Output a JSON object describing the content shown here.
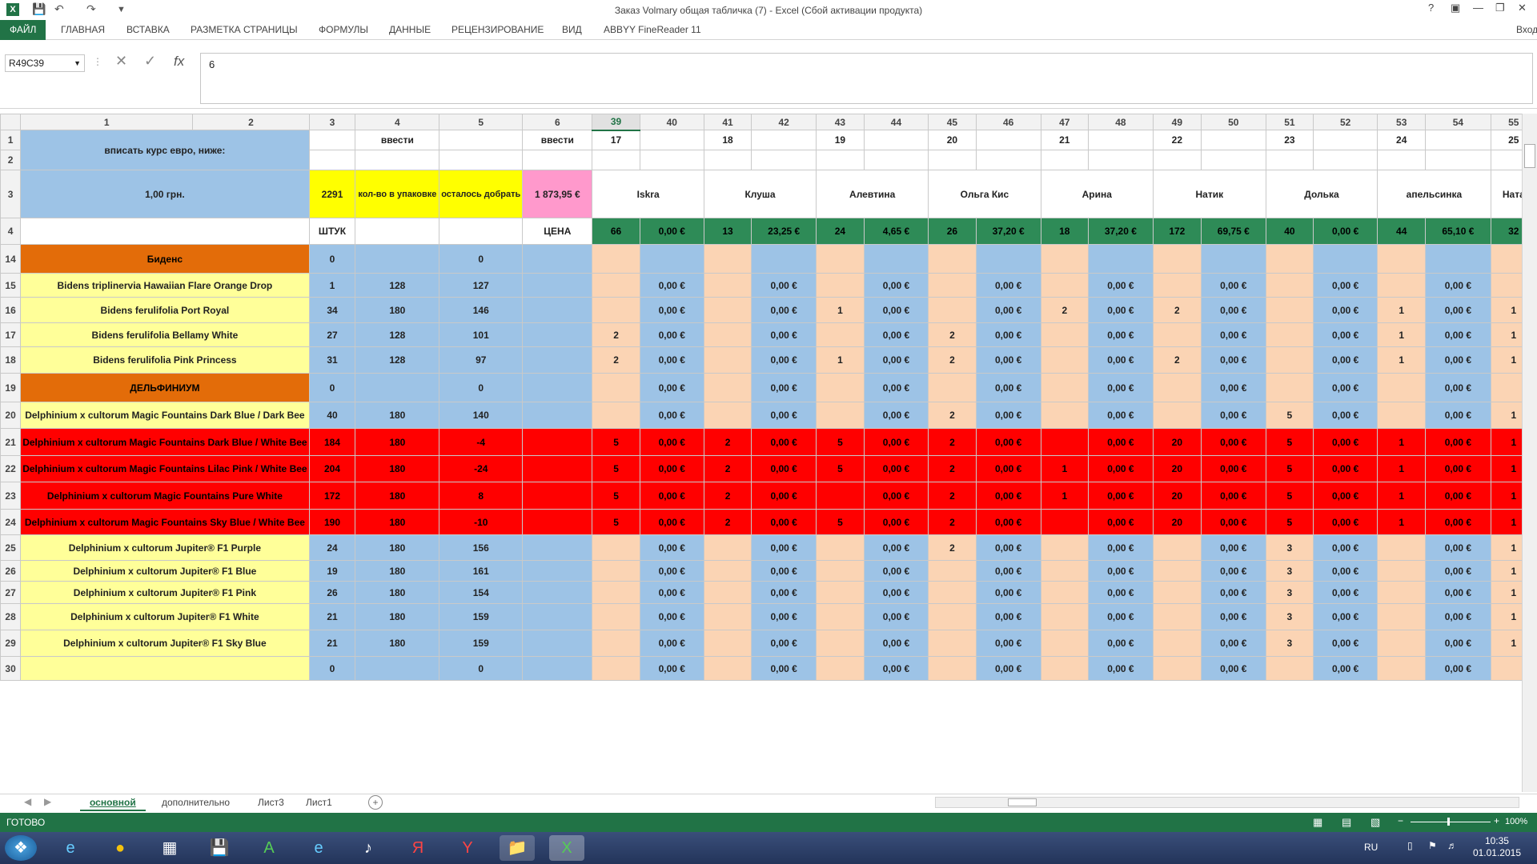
{
  "window": {
    "title": "Заказ Volmary общая табличка (7) - Excel (Сбой активации продукта)",
    "help": "?",
    "signin": "Вход"
  },
  "ribbon": {
    "tabs": [
      "ФАЙЛ",
      "ГЛАВНАЯ",
      "ВСТАВКА",
      "РАЗМЕТКА СТРАНИЦЫ",
      "ФОРМУЛЫ",
      "ДАННЫЕ",
      "РЕЦЕНЗИРОВАНИЕ",
      "ВИД",
      "ABBYY FineReader 11"
    ]
  },
  "formula_bar": {
    "name_box": "R49C39",
    "fx": "fx",
    "value": "6"
  },
  "columns": [
    "1",
    "2",
    "3",
    "4",
    "5",
    "6",
    "39",
    "40",
    "41",
    "42",
    "43",
    "44",
    "45",
    "46",
    "47",
    "48",
    "49",
    "50",
    "51",
    "52",
    "53",
    "54",
    "55"
  ],
  "selected_column": "39",
  "row1": {
    "label": "вписать курс евро, ниже:",
    "c4": "ввести",
    "c6": "ввести",
    "nums": [
      "17",
      "18",
      "19",
      "20",
      "21",
      "22",
      "23",
      "24",
      "25"
    ]
  },
  "row3": {
    "rate": "1,00 грн.",
    "total": "2291",
    "pack": "кол-во в упаковке",
    "left": "осталось добрать",
    "sum": "1 873,95 €"
  },
  "customers": [
    "Iskra",
    "Клуша",
    "Алевтина",
    "Ольга Кис",
    "Арина",
    "Натик",
    "Долька",
    "апельсинка",
    "Ната"
  ],
  "row4": {
    "unit": "ШТУК",
    "price": "ЦЕНА",
    "qty": [
      "66",
      "13",
      "24",
      "26",
      "18",
      "172",
      "40",
      "44",
      "32"
    ],
    "sums": [
      "0,00 €",
      "23,25 €",
      "4,65 €",
      "37,20 €",
      "37,20 €",
      "69,75 €",
      "0,00 €",
      "65,10 €"
    ]
  },
  "rows": [
    {
      "n": "14",
      "name": "Биденс",
      "cat": "bidens",
      "total": "0",
      "pack": "",
      "left": "0",
      "q": [
        "",
        "",
        "",
        "",
        "",
        "",
        "",
        "",
        ""
      ]
    },
    {
      "n": "15",
      "name": "Bidens triplinervia Hawaiian Flare Orange Drop",
      "cat": "y",
      "total": "1",
      "pack": "128",
      "left": "127",
      "q": [
        "",
        "",
        "",
        "",
        "",
        "",
        "",
        "",
        ""
      ]
    },
    {
      "n": "16",
      "name": "Bidens ferulifolia Port Royal",
      "cat": "y",
      "total": "34",
      "pack": "180",
      "left": "146",
      "q": [
        "",
        "",
        "1",
        "",
        "2",
        "2",
        "",
        "1",
        "1"
      ]
    },
    {
      "n": "17",
      "name": "Bidens ferulifolia Bellamy White",
      "cat": "y",
      "total": "27",
      "pack": "128",
      "left": "101",
      "q": [
        "2",
        "",
        "",
        "2",
        "",
        "",
        "",
        "1",
        "1"
      ]
    },
    {
      "n": "18",
      "name": "Bidens ferulifolia Pink Princess",
      "cat": "y",
      "total": "31",
      "pack": "128",
      "left": "97",
      "q": [
        "2",
        "",
        "1",
        "2",
        "",
        "2",
        "",
        "1",
        "1"
      ]
    },
    {
      "n": "19",
      "name": "ДЕЛЬФИНИУМ",
      "cat": "delph",
      "total": "0",
      "pack": "",
      "left": "0",
      "q": [
        "",
        "",
        "",
        "",
        "",
        "",
        "",
        "",
        ""
      ]
    },
    {
      "n": "20",
      "name": "Delphinium x cultorum Magic Fountains Dark Blue / Dark Bee",
      "cat": "y",
      "total": "40",
      "pack": "180",
      "left": "140",
      "q": [
        "",
        "",
        "",
        "2",
        "",
        "",
        "5",
        "",
        "1"
      ]
    },
    {
      "n": "21",
      "name": "Delphinium x cultorum Magic Fountains Dark Blue / White Bee",
      "cat": "r",
      "total": "184",
      "pack": "180",
      "left": "-4",
      "q": [
        "5",
        "2",
        "5",
        "2",
        "",
        "20",
        "5",
        "1",
        "1"
      ]
    },
    {
      "n": "22",
      "name": "Delphinium x cultorum Magic Fountains Lilac Pink / White Bee",
      "cat": "r",
      "total": "204",
      "pack": "180",
      "left": "-24",
      "q": [
        "5",
        "2",
        "5",
        "2",
        "1",
        "20",
        "5",
        "1",
        "1"
      ]
    },
    {
      "n": "23",
      "name": "Delphinium x cultorum Magic Fountains Pure White",
      "cat": "r",
      "total": "172",
      "pack": "180",
      "left": "8",
      "q": [
        "5",
        "2",
        "",
        "2",
        "1",
        "20",
        "5",
        "1",
        "1"
      ]
    },
    {
      "n": "24",
      "name": "Delphinium x cultorum Magic Fountains Sky Blue / White Bee",
      "cat": "r",
      "total": "190",
      "pack": "180",
      "left": "-10",
      "q": [
        "5",
        "2",
        "5",
        "2",
        "",
        "20",
        "5",
        "1",
        "1"
      ]
    },
    {
      "n": "25",
      "name": "Delphinium x cultorum Jupiter® F1 Purple",
      "cat": "y",
      "total": "24",
      "pack": "180",
      "left": "156",
      "q": [
        "",
        "",
        "",
        "2",
        "",
        "",
        "3",
        "",
        "1"
      ]
    },
    {
      "n": "26",
      "name": "Delphinium x cultorum Jupiter® F1 Blue",
      "cat": "y",
      "total": "19",
      "pack": "180",
      "left": "161",
      "q": [
        "",
        "",
        "",
        "",
        "",
        "",
        "3",
        "",
        "1"
      ]
    },
    {
      "n": "27",
      "name": "Delphinium x cultorum Jupiter® F1 Pink",
      "cat": "y",
      "total": "26",
      "pack": "180",
      "left": "154",
      "q": [
        "",
        "",
        "",
        "",
        "",
        "",
        "3",
        "",
        "1"
      ]
    },
    {
      "n": "28",
      "name": "Delphinium x cultorum Jupiter® F1 White",
      "cat": "y",
      "total": "21",
      "pack": "180",
      "left": "159",
      "q": [
        "",
        "",
        "",
        "",
        "",
        "",
        "3",
        "",
        "1"
      ]
    },
    {
      "n": "29",
      "name": "Delphinium x cultorum Jupiter® F1 Sky Blue",
      "cat": "y",
      "total": "21",
      "pack": "180",
      "left": "159",
      "q": [
        "",
        "",
        "",
        "",
        "",
        "",
        "3",
        "",
        "1"
      ]
    },
    {
      "n": "30",
      "name": "",
      "cat": "y",
      "total": "0",
      "pack": "",
      "left": "0",
      "q": [
        "",
        "",
        "",
        "",
        "",
        "",
        "",
        "",
        ""
      ]
    }
  ],
  "zero_eur": "0,00 €",
  "sheet_tabs": [
    "основной",
    "дополнительно",
    "Лист3",
    "Лист1"
  ],
  "status": {
    "ready": "ГОТОВО",
    "zoom": "100%"
  },
  "taskbar": {
    "lang": "RU",
    "time": "10:35",
    "date": "01.01.2015"
  }
}
